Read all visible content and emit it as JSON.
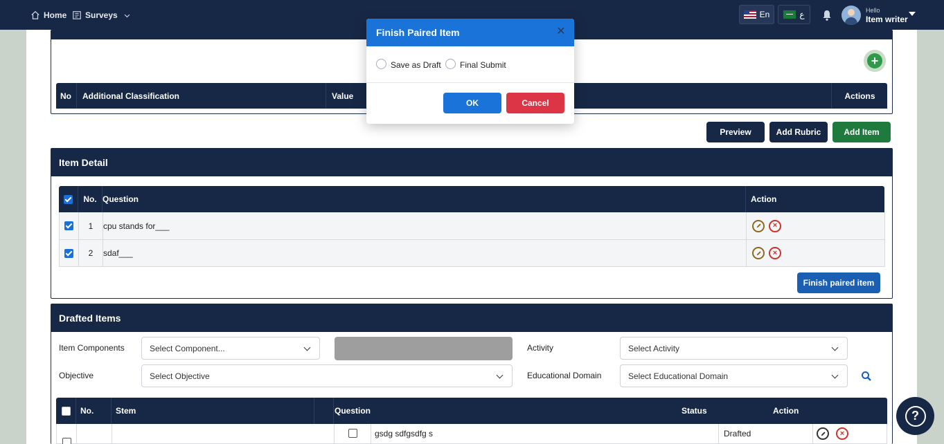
{
  "nav": {
    "home_label": "Home",
    "surveys_label": "Surveys",
    "lang_en": "En",
    "lang_ar": "ع",
    "hello": "Hello",
    "user_name": "Item writer"
  },
  "classification": {
    "headers": [
      "No",
      "Additional Classification",
      "Value",
      "Actions"
    ]
  },
  "toolbar": {
    "preview_label": "Preview",
    "add_rubric_label": "Add Rubric",
    "add_item_label": "Add Item"
  },
  "item_detail": {
    "title": "Item Detail",
    "headers": {
      "no": "No.",
      "question": "Question",
      "action": "Action"
    },
    "rows": [
      {
        "no": "1",
        "question": "cpu stands for___"
      },
      {
        "no": "2",
        "question": "sdaf___"
      }
    ],
    "finish_label": "Finish paired item"
  },
  "drafted": {
    "title": "Drafted Items",
    "filters": {
      "components_label": "Item Components",
      "components_value": "Select Component...",
      "activity_label": "Activity",
      "activity_value": "Select Activity",
      "objective_label": "Objective",
      "objective_value": "Select Objective",
      "domain_label": "Educational Domain",
      "domain_value": "Select Educational Domain"
    },
    "headers": {
      "no": "No.",
      "stem": "Stem",
      "question": "Question",
      "status": "Status",
      "action": "Action"
    },
    "rows": [
      {
        "question": "gsdg sdfgsdfg s",
        "status": "Drafted"
      }
    ]
  },
  "modal": {
    "title": "Finish Paired Item",
    "option_draft": "Save as Draft",
    "option_final": "Final Submit",
    "ok_label": "OK",
    "cancel_label": "Cancel"
  },
  "help": {
    "symbol": "?"
  }
}
